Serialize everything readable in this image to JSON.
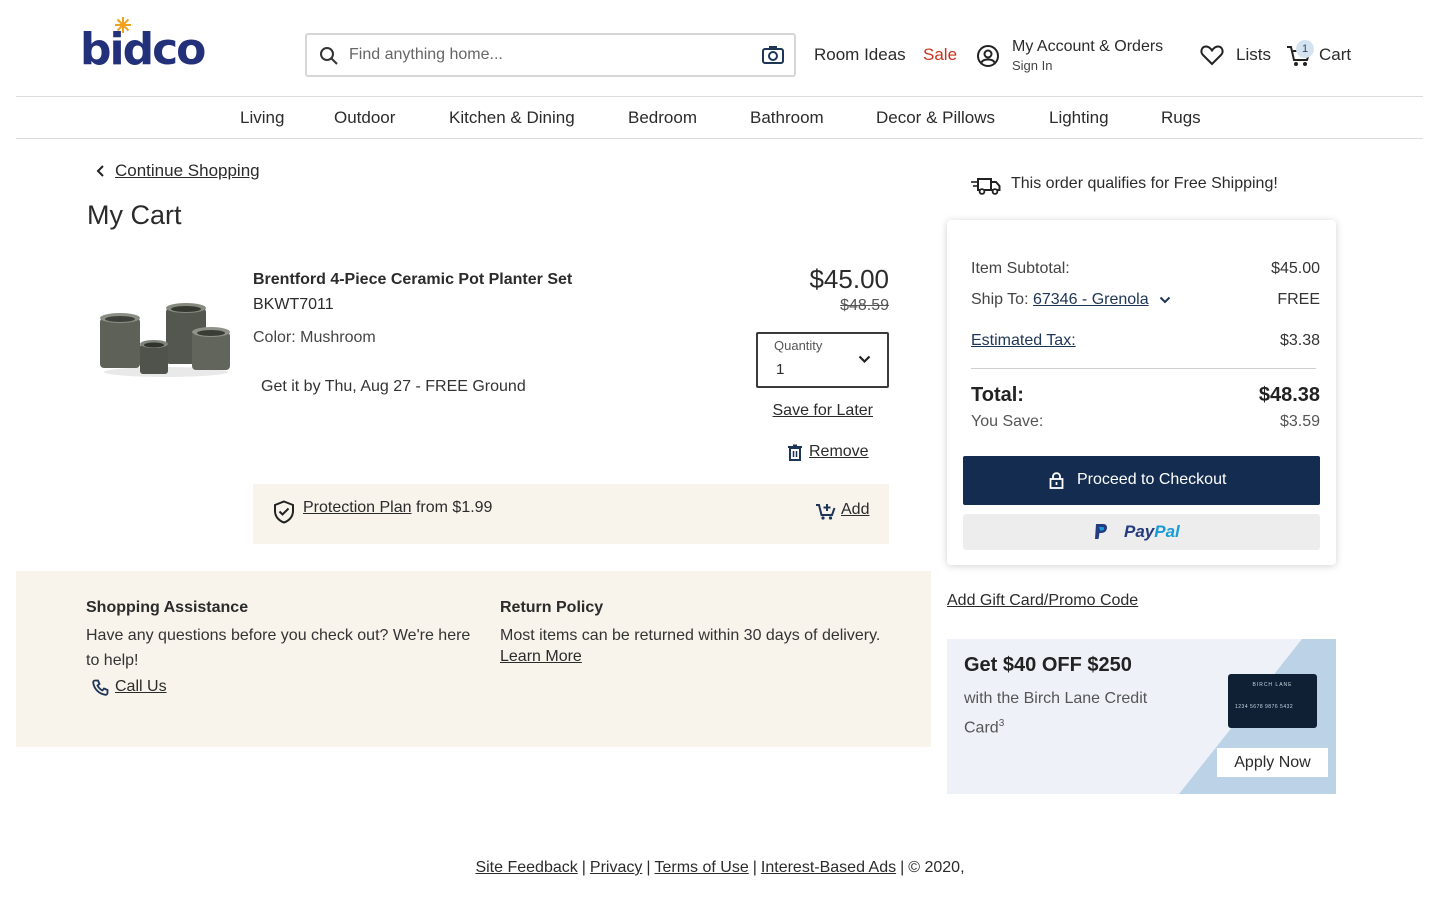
{
  "brand": {
    "logo_text": "bidco"
  },
  "header": {
    "search_placeholder": "Find anything home...",
    "room_ideas": "Room Ideas",
    "sale": "Sale",
    "account_title": "My Account & Orders",
    "account_sub": "Sign In",
    "lists": "Lists",
    "cart_label": "Cart",
    "cart_count": "1"
  },
  "categories": [
    "Living",
    "Outdoor",
    "Kitchen & Dining",
    "Bedroom",
    "Bathroom",
    "Decor & Pillows",
    "Lighting",
    "Rugs"
  ],
  "cart": {
    "continue_shopping": "Continue Shopping",
    "title": "My Cart",
    "item": {
      "name": "Brentford 4-Piece Ceramic Pot Planter Set",
      "sku": "BKWT7011",
      "color": "Color: Mushroom",
      "delivery": "Get it by Thu, Aug 27 - FREE Ground",
      "price": "$45.00",
      "old_price": "$48.59",
      "quantity_label": "Quantity",
      "quantity_value": "1",
      "save_for_later": "Save for Later",
      "remove": "Remove"
    },
    "protection": {
      "link": "Protection Plan",
      "suffix": "from $1.99",
      "add": "Add"
    }
  },
  "assistance": {
    "shopping_title": "Shopping Assistance",
    "shopping_text": "Have any questions before you check out? We're here to help!",
    "call_us": "Call Us",
    "return_title": "Return Policy",
    "return_text": "Most items can be returned within 30 days of delivery.",
    "learn_more": "Learn More"
  },
  "summary": {
    "free_shipping": "This order qualifies for Free Shipping!",
    "subtotal_label": "Item Subtotal:",
    "subtotal_value": "$45.00",
    "ship_to_label": "Ship To:",
    "ship_to_value": "67346 - Grenola",
    "ship_value": "FREE",
    "tax_label": "Estimated Tax:",
    "tax_value": "$3.38",
    "total_label": "Total:",
    "total_value": "$48.38",
    "save_label": "You Save:",
    "save_value": "$3.59",
    "checkout": "Proceed to Checkout",
    "paypal_a": "Pay",
    "paypal_b": "Pal",
    "gift_card": "Add Gift Card/Promo Code"
  },
  "promo": {
    "headline": "Get $40 OFF $250",
    "text": "with the Birch Lane Credit Card",
    "sup": "3",
    "card_name": "BIRCH LANE",
    "card_number": "1234 5678 9876 5432",
    "apply": "Apply Now"
  },
  "footer": {
    "links": [
      "Site Feedback",
      "Privacy",
      "Terms of Use",
      "Interest-Based Ads"
    ],
    "copyright": "© 2020,"
  },
  "colors": {
    "navy": "#142c4f",
    "sale_red": "#c8321e",
    "cream": "#f8f3eb",
    "logo_blue": "#23307a"
  }
}
